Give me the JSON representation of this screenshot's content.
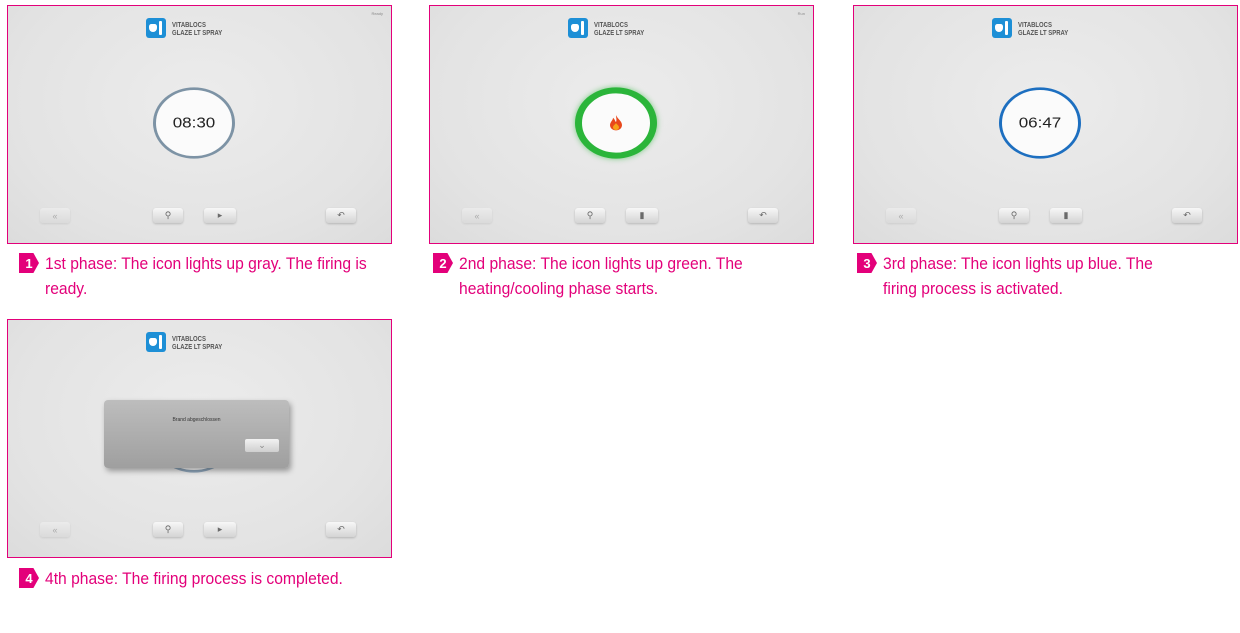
{
  "product": {
    "line1": "VITABLOCS",
    "line2": "GLAZE LT SPRAY"
  },
  "colors": {
    "accent": "#e3007a",
    "gray_ring": "#7d93a5",
    "green_ring": "#2bb53a",
    "blue_ring": "#1d6fc0",
    "logo": "#1d8fd6"
  },
  "icons": {
    "left": "chevron-double-left-icon",
    "key": "key-icon",
    "play": "play-icon",
    "back": "return-arrow-icon",
    "dialog_ok": "chevron-down-icon",
    "fire": "flame-icon"
  },
  "panels": [
    {
      "number": "1",
      "status": "Ready",
      "dial": "08:30",
      "caption": "1st phase: The icon lights up gray. The firing is ready."
    },
    {
      "number": "2",
      "status": "Run",
      "dial": "",
      "caption": "2nd phase: The icon lights up green. The heating/cooling phase starts."
    },
    {
      "number": "3",
      "status": "",
      "dial": "06:47",
      "caption": "3rd phase: The icon lights up blue. The firing process is activated."
    },
    {
      "number": "4",
      "status": "",
      "dial": "",
      "dialog": "Brand abgeschlossen",
      "caption": "4th phase: The firing process is completed."
    }
  ],
  "glyphs": {
    "left": "«",
    "key": "⚲",
    "play": "▸",
    "pause": "▮",
    "back": "↶",
    "ok": "⌄"
  }
}
